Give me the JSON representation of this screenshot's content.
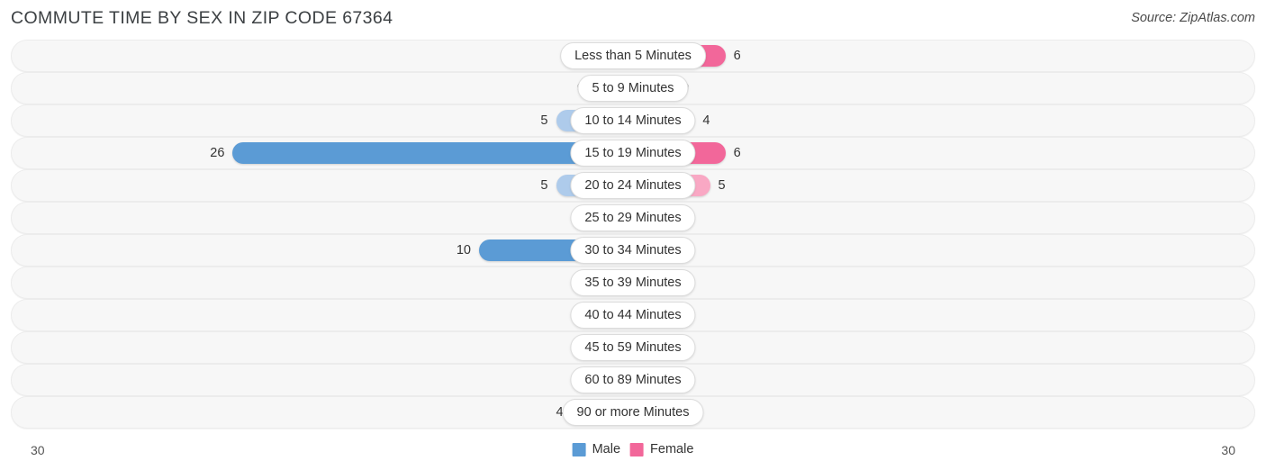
{
  "header": {
    "title": "COMMUTE TIME BY SEX IN ZIP CODE 67364",
    "source": "Source: ZipAtlas.com"
  },
  "footer": {
    "axis_left": "30",
    "axis_right": "30"
  },
  "legend": {
    "items": [
      {
        "label": "Male",
        "color": "#5B9BD5"
      },
      {
        "label": "Female",
        "color": "#F2679A"
      }
    ]
  },
  "colors": {
    "male_strong": "#5B9BD5",
    "male_light": "#AECBEB",
    "female_strong": "#F2679A",
    "female_light": "#F9A8C4",
    "track": "#F7F7F7",
    "gridline": "#E3E3E3"
  },
  "chart_data": {
    "type": "bar",
    "title": "COMMUTE TIME BY SEX IN ZIP CODE 67364",
    "subtype": "diverging-horizontal",
    "xlabel": "",
    "ylabel": "",
    "axis_max": 30,
    "grid": true,
    "legend_position": "bottom-center",
    "categories": [
      "Less than 5 Minutes",
      "5 to 9 Minutes",
      "10 to 14 Minutes",
      "15 to 19 Minutes",
      "20 to 24 Minutes",
      "25 to 29 Minutes",
      "30 to 34 Minutes",
      "35 to 39 Minutes",
      "40 to 44 Minutes",
      "45 to 59 Minutes",
      "60 to 89 Minutes",
      "90 or more Minutes"
    ],
    "series": [
      {
        "name": "Male",
        "values": [
          0,
          0,
          5,
          26,
          5,
          1,
          10,
          0,
          1,
          0,
          0,
          4
        ]
      },
      {
        "name": "Female",
        "values": [
          6,
          0,
          4,
          6,
          5,
          0,
          0,
          0,
          0,
          0,
          0,
          0
        ]
      }
    ]
  }
}
